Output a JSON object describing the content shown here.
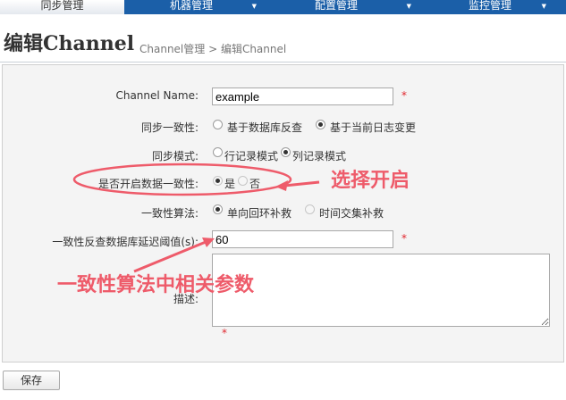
{
  "nav": {
    "tabs": [
      {
        "label": "同步管理",
        "active": true
      },
      {
        "label": "机器管理",
        "active": false
      },
      {
        "label": "配置管理",
        "active": false
      },
      {
        "label": "监控管理",
        "active": false
      }
    ],
    "caret": "▼"
  },
  "header": {
    "title": "编辑Channel",
    "breadcrumb": "Channel管理  >  编辑Channel"
  },
  "form": {
    "channel_name": {
      "label": "Channel Name:",
      "value": "example",
      "required": "*"
    },
    "consistency": {
      "label": "同步一致性:",
      "options": [
        "基于数据库反查",
        "基于当前日志变更"
      ],
      "selected_index": 1
    },
    "sync_mode": {
      "label": "同步模式:",
      "options": [
        "行记录模式",
        "列记录模式"
      ],
      "selected_index": 1
    },
    "enable_consistency": {
      "label": "是否开启数据一致性:",
      "options": [
        "是",
        "否"
      ],
      "selected_index": 0
    },
    "algorithm": {
      "label": "一致性算法:",
      "options": [
        "单向回环补救",
        "时间交集补救"
      ],
      "selected_index": 0
    },
    "delay_threshold": {
      "label": "一致性反查数据库延迟阈值(s):",
      "value": "60",
      "required": "*"
    },
    "description": {
      "label": "描述:",
      "value": "",
      "required": "*"
    }
  },
  "actions": {
    "save_label": "保存"
  },
  "annotations": {
    "note_enable": "选择开启",
    "note_params": "一致性算法中相关参数",
    "color": "#ee5b6a"
  },
  "colors": {
    "nav_bg": "#1b5fa8",
    "required": "#e0262d"
  }
}
